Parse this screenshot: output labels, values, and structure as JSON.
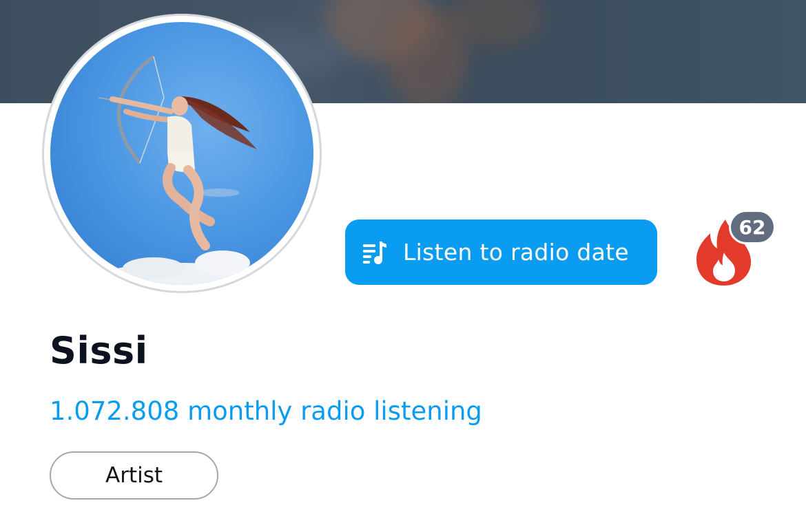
{
  "artist": {
    "name": "Sissi",
    "monthly_listeners_text": "1.072.808 monthly radio listening",
    "tag": "Artist"
  },
  "actions": {
    "listen_button_label": "Listen to radio date",
    "listen_button_icon": "playlist-music-icon",
    "fire_icon": "fire-icon",
    "fire_count": "62"
  },
  "colors": {
    "accent": "#0a9cf1",
    "fire": "#e23a2b",
    "badge": "#616d7e",
    "name_text": "#0d1220"
  }
}
